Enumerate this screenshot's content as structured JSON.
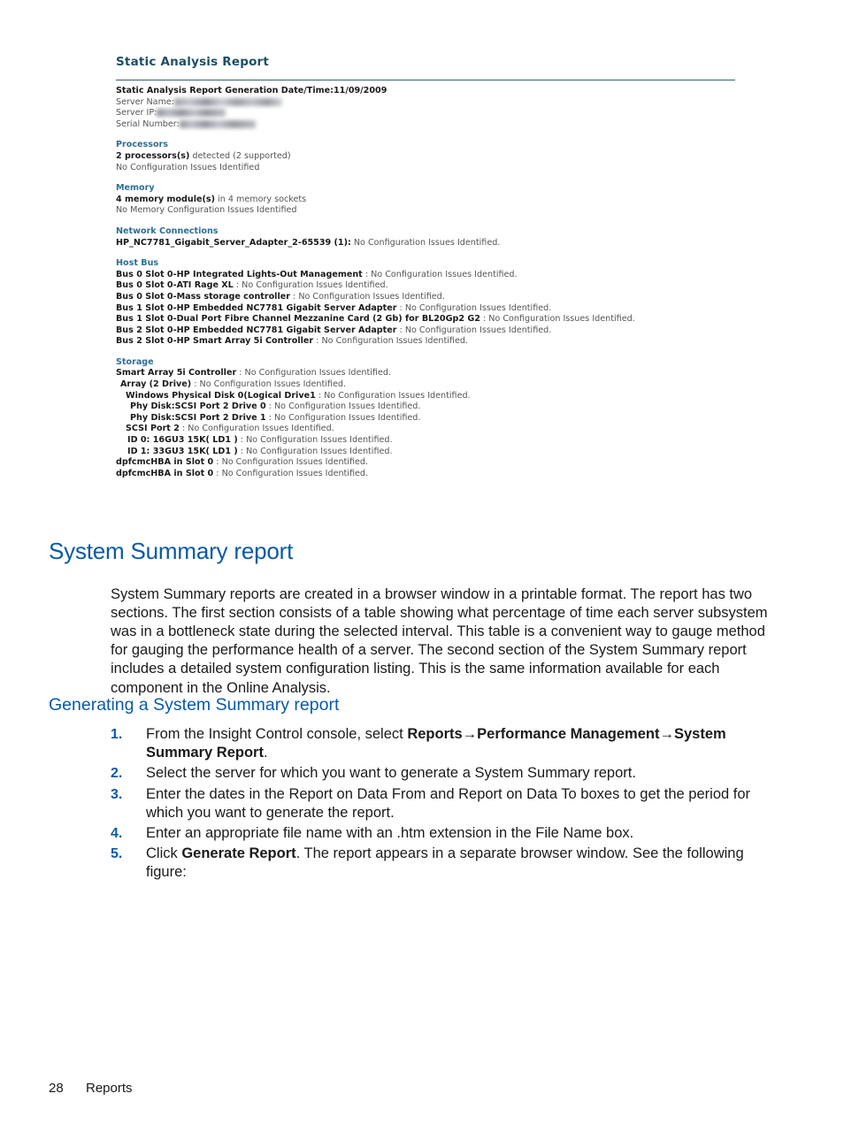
{
  "figure": {
    "title": "Static Analysis Report",
    "generation_line": "Static Analysis Report Generation Date/Time:11/09/2009",
    "fields": [
      {
        "label": "Server Name:",
        "value_redacted": true
      },
      {
        "label": "Server IP:",
        "value_redacted": true
      },
      {
        "label": "Serial Number:",
        "value_redacted": true
      }
    ],
    "sections": [
      {
        "heading": "Processors",
        "lines": [
          {
            "bold": "2 processors(s)",
            "rest": " detected (2 supported)"
          },
          {
            "bold": "",
            "rest": "No Configuration Issues Identified"
          }
        ]
      },
      {
        "heading": "Memory",
        "lines": [
          {
            "bold": "4 memory module(s)",
            "rest": " in 4 memory sockets"
          },
          {
            "bold": "",
            "rest": "No Memory Configuration Issues Identified"
          }
        ]
      },
      {
        "heading": "Network Connections",
        "lines": [
          {
            "bold": "HP_NC7781_Gigabit_Server_Adapter_2-65539 (1):",
            "rest": " No Configuration Issues Identified."
          }
        ]
      },
      {
        "heading": "Host Bus",
        "lines": [
          {
            "bold": "Bus 0 Slot 0-HP Integrated Lights-Out Management",
            "rest": " : No Configuration Issues Identified."
          },
          {
            "bold": "Bus 0 Slot 0-ATI Rage XL",
            "rest": " : No Configuration Issues Identified."
          },
          {
            "bold": "Bus 0 Slot 0-Mass storage controller",
            "rest": " : No Configuration Issues Identified."
          },
          {
            "bold": "Bus 1 Slot 0-HP Embedded NC7781 Gigabit Server Adapter",
            "rest": " : No Configuration Issues Identified."
          },
          {
            "bold": "Bus 1 Slot 0-Dual Port Fibre Channel Mezzanine Card (2 Gb) for BL20Gp2 G2",
            "rest": " : No Configuration Issues Identified."
          },
          {
            "bold": "Bus 2 Slot 0-HP Embedded NC7781 Gigabit Server Adapter",
            "rest": " : No Configuration Issues Identified."
          },
          {
            "bold": "Bus 2 Slot 0-HP Smart Array 5i Controller",
            "rest": " : No Configuration Issues Identified."
          }
        ]
      },
      {
        "heading": "Storage",
        "lines": [
          {
            "bold": "Smart Array 5i Controller",
            "rest": " : No Configuration Issues Identified.",
            "indent": 0
          },
          {
            "bold": "Array (2 Drive)",
            "rest": " : No Configuration Issues Identified.",
            "indent": 1
          },
          {
            "bold": "Windows Physical Disk 0(Logical Drive1",
            "rest": " : No Configuration Issues Identified.",
            "indent": 2
          },
          {
            "bold": "Phy Disk:SCSI Port 2 Drive 0",
            "rest": " : No Configuration Issues Identified.",
            "indent": 3
          },
          {
            "bold": "Phy Disk:SCSI Port 2 Drive 1",
            "rest": " : No Configuration Issues Identified.",
            "indent": 3
          },
          {
            "bold": "SCSI Port 2",
            "rest": " : No Configuration Issues Identified.",
            "indent": 2
          },
          {
            "bold": "ID 0: 16GU3 15K( LD1 )",
            "rest": " : No Configuration Issues Identified.",
            "indent": 3
          },
          {
            "bold": "ID 1: 33GU3 15K( LD1 )",
            "rest": " : No Configuration Issues Identified.",
            "indent": 3
          },
          {
            "bold": "dpfcmcHBA in Slot 0",
            "rest": " : No Configuration Issues Identified.",
            "indent": 0
          },
          {
            "bold": "dpfcmcHBA in Slot 0",
            "rest": " : No Configuration Issues Identified.",
            "indent": 0
          }
        ]
      }
    ]
  },
  "section": {
    "heading": "System Summary report",
    "paragraph": "System Summary reports are created in a browser window in a printable format. The report has two sections. The first section consists of a table showing what percentage of time each server subsystem was in a bottleneck state during the selected interval. This table is a convenient way to gauge method for gauging the performance health of a server. The second section of the System Summary report includes a detailed system configuration listing. This is the same information available for each component in the Online Analysis.",
    "subheading": "Generating a System Summary report",
    "steps": [
      {
        "num": "1.",
        "parts": [
          {
            "t": "From the Insight Control console, select ",
            "b": false
          },
          {
            "t": "Reports",
            "b": true
          },
          {
            "t": "→",
            "b": true
          },
          {
            "t": "Performance Management",
            "b": true
          },
          {
            "t": "→",
            "b": true
          },
          {
            "t": "System Summary Report",
            "b": true
          },
          {
            "t": ".",
            "b": false
          }
        ]
      },
      {
        "num": "2.",
        "parts": [
          {
            "t": "Select the server for which you want to generate a System Summary report.",
            "b": false
          }
        ]
      },
      {
        "num": "3.",
        "parts": [
          {
            "t": "Enter the dates in the Report on Data From and Report on Data To boxes to get the period for which you want to generate the report.",
            "b": false
          }
        ]
      },
      {
        "num": "4.",
        "parts": [
          {
            "t": "Enter an appropriate file name with an .htm extension in the File Name box.",
            "b": false
          }
        ]
      },
      {
        "num": "5.",
        "parts": [
          {
            "t": "Click ",
            "b": false
          },
          {
            "t": "Generate Report",
            "b": true
          },
          {
            "t": ". The report appears in a separate browser window. See the following figure:",
            "b": false
          }
        ]
      }
    ]
  },
  "footer": {
    "page_number": "28",
    "chapter": "Reports"
  },
  "colors": {
    "heading_blue": "#0a5aa6",
    "figure_heading_blue": "#2e6e96",
    "figure_title": "#1f4e66",
    "rule": "#39606e",
    "body_text": "#1a1a1a"
  }
}
